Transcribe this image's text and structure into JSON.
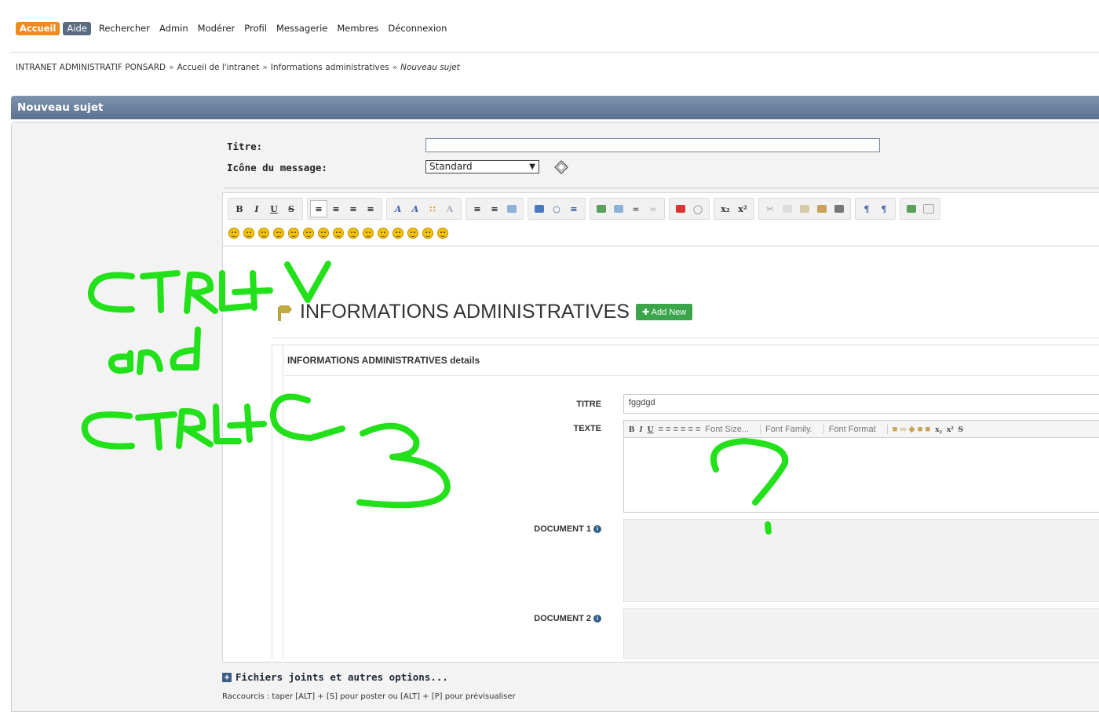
{
  "nav": {
    "home": "Accueil",
    "help": "Aide",
    "links": [
      "Rechercher",
      "Admin",
      "Modérer",
      "Profil",
      "Messagerie",
      "Membres",
      "Déconnexion"
    ]
  },
  "breadcrumb": {
    "items": [
      "INTRANET ADMINISTRATIF PONSARD",
      "Accueil de l'intranet",
      "Informations administratives"
    ],
    "current": "Nouveau sujet",
    "separator": "»"
  },
  "header": {
    "title": "Nouveau sujet"
  },
  "form": {
    "title_label": "Titre:",
    "title_value": "",
    "icon_label": "Icône du message:",
    "icon_selected": "Standard"
  },
  "pasted": {
    "heading": "INFORMATIONS ADMINISTRATIVES",
    "add_button": "Add New",
    "details_header": "INFORMATIONS ADMINISTRATIVES details",
    "fields": {
      "titre_label": "TITRE",
      "titre_value": "fggdgd",
      "texte_label": "TEXTE",
      "doc1_label": "DOCUMENT 1",
      "doc2_label": "DOCUMENT 2"
    },
    "rte": {
      "font_size": "Font Size...",
      "font_family": "Font Family.",
      "font_format": "Font Format"
    }
  },
  "bottom": {
    "more_options": "Fichiers joints et autres options...",
    "shortcut_hint": "Raccourcis : taper [ALT] + [S] pour poster ou [ALT] + [P] pour prévisualiser"
  },
  "colors": {
    "accent_orange": "#f08a1c",
    "header_blue": "#5b7290",
    "scribble_green": "#22e01a",
    "add_new_green": "#3aa54a"
  }
}
